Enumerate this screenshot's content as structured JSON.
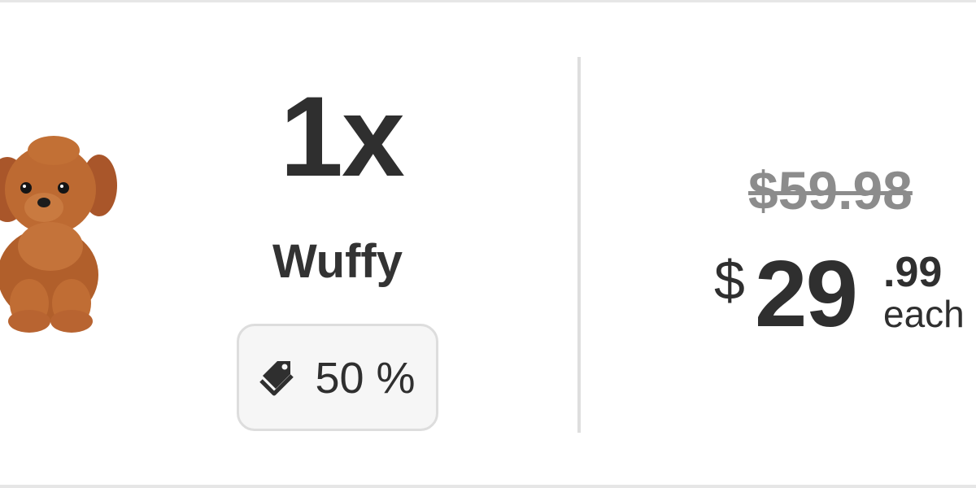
{
  "product": {
    "quantity": "1x",
    "name": "Wuffy",
    "image_icon": "plush-puppy-image",
    "discount": {
      "icon": "tag-icon",
      "label": "50 %"
    },
    "price": {
      "original": "$59.98",
      "currency": "$",
      "whole": "29",
      "cents": ".99",
      "unit": "each"
    }
  },
  "colors": {
    "text": "#2f2f2f",
    "strikethrough_price": "#8c8c8c",
    "badge_background": "#f6f6f6",
    "badge_border": "#dddddd",
    "divider": "#dedede",
    "plush_fur": "#b8652e"
  }
}
